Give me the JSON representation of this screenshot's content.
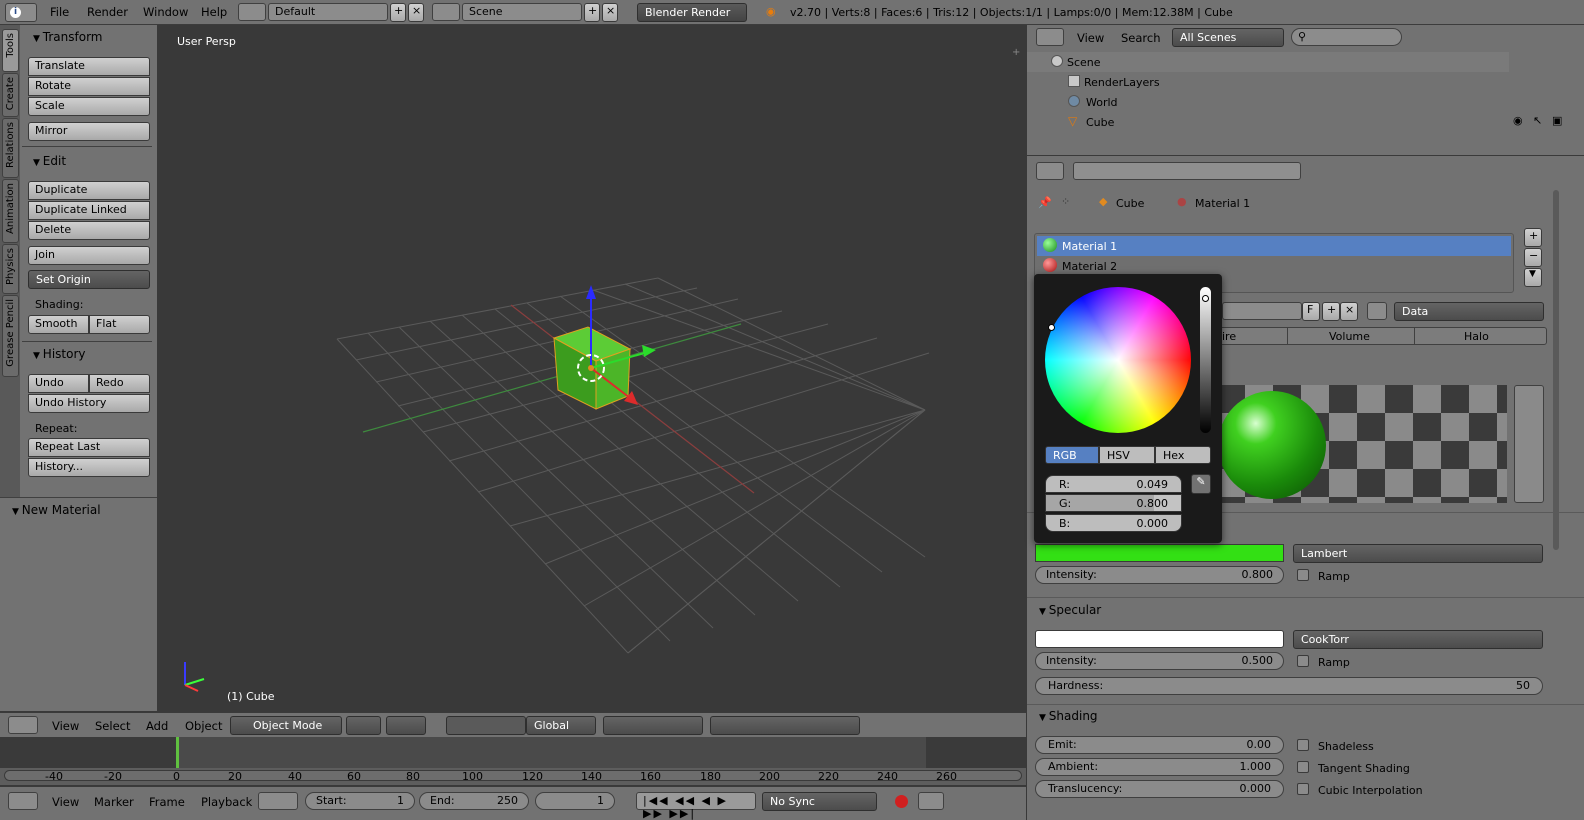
{
  "topbar": {
    "menus": [
      "File",
      "Render",
      "Window",
      "Help"
    ],
    "layout": "Default",
    "scene": "Scene",
    "engine": "Blender Render",
    "stats": "v2.70 | Verts:8 | Faces:6 | Tris:12 | Objects:1/1 | Lamps:0/0 | Mem:12.38M | Cube"
  },
  "tabs": [
    "Tools",
    "Create",
    "Relations",
    "Animation",
    "Physics",
    "Grease Pencil"
  ],
  "tools": {
    "transform_title": "Transform",
    "translate": "Translate",
    "rotate": "Rotate",
    "scale": "Scale",
    "mirror": "Mirror",
    "edit_title": "Edit",
    "duplicate": "Duplicate",
    "duplicate_linked": "Duplicate Linked",
    "delete": "Delete",
    "join": "Join",
    "set_origin": "Set Origin",
    "shading_label": "Shading:",
    "smooth": "Smooth",
    "flat": "Flat",
    "history_title": "History",
    "undo": "Undo",
    "redo": "Redo",
    "undo_history": "Undo History",
    "repeat_label": "Repeat:",
    "repeat_last": "Repeat Last",
    "history_dots": "History...",
    "new_material": "New Material"
  },
  "viewport": {
    "persp": "User Persp",
    "object_label": "(1) Cube"
  },
  "vheader": {
    "view": "View",
    "select": "Select",
    "add": "Add",
    "object": "Object",
    "mode": "Object Mode",
    "orientation": "Global"
  },
  "timeline": {
    "ticks": [
      "-40",
      "-20",
      "0",
      "20",
      "40",
      "60",
      "80",
      "100",
      "120",
      "140",
      "160",
      "180",
      "200",
      "220",
      "240",
      "260"
    ]
  },
  "tlheader": {
    "view": "View",
    "marker": "Marker",
    "frame": "Frame",
    "playback": "Playback",
    "start_label": "Start:",
    "start": "1",
    "end_label": "End:",
    "end": "250",
    "current": "1",
    "sync": "No Sync"
  },
  "outliner": {
    "view": "View",
    "search": "Search",
    "filter": "All Scenes",
    "items": [
      "Scene",
      "RenderLayers",
      "World",
      "Cube"
    ]
  },
  "props": {
    "breadcrumb_cube": "Cube",
    "breadcrumb_material": "Material 1",
    "materials": [
      "Material 1",
      "Material 2"
    ],
    "f_label": "F",
    "data": "Data",
    "tabs": [
      "ire",
      "Volume",
      "Halo"
    ],
    "diffuse_shader": "Lambert",
    "diffuse_intensity_label": "Intensity:",
    "diffuse_intensity": "0.800",
    "ramp": "Ramp",
    "specular_title": "Specular",
    "specular_shader": "CookTorr",
    "spec_intensity_label": "Intensity:",
    "spec_intensity": "0.500",
    "hardness_label": "Hardness:",
    "hardness": "50",
    "shading_title": "Shading",
    "emit_label": "Emit:",
    "emit": "0.00",
    "ambient_label": "Ambient:",
    "ambient": "1.000",
    "translucency_label": "Translucency:",
    "translucency": "0.000",
    "shadeless": "Shadeless",
    "tangent": "Tangent Shading",
    "cubic": "Cubic Interpolation"
  },
  "picker": {
    "modes": [
      "RGB",
      "HSV",
      "Hex"
    ],
    "r_label": "R:",
    "r": "0.049",
    "g_label": "G:",
    "g": "0.800",
    "b_label": "B:",
    "b": "0.000"
  },
  "colors": {
    "diffuse": "#33e014",
    "selected_row": "#5680c2"
  }
}
